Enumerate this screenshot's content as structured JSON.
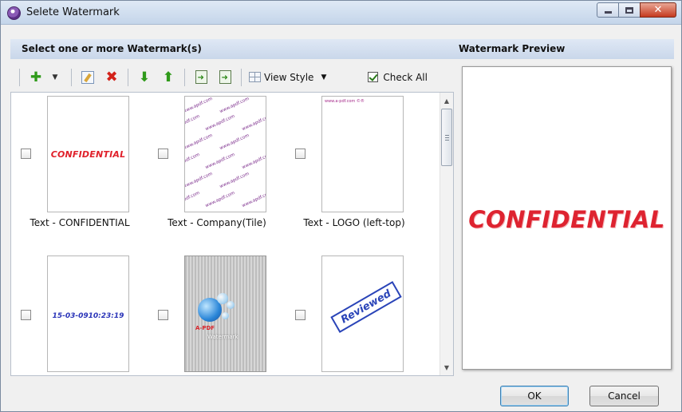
{
  "window": {
    "title": "Selete Watermark"
  },
  "left_panel": {
    "header": "Select one or more Watermark(s)"
  },
  "toolbar": {
    "view_style_label": "View Style",
    "check_all_label": "Check All",
    "check_all_checked": true
  },
  "watermarks": [
    {
      "caption": "Text - CONFIDENTIAL",
      "thumb_text": "CONFIDENTIAL",
      "checked": false
    },
    {
      "caption": "Text - Company(Tile)",
      "thumb_text": "www.apdf.com",
      "checked": false
    },
    {
      "caption": "Text - LOGO (left-top)",
      "thumb_text": "www.a-pdf.com ©®",
      "checked": false
    },
    {
      "caption": "",
      "thumb_text": "15-03-0910:23:19",
      "checked": false
    },
    {
      "caption": "",
      "thumb_text": "A-PDF",
      "thumb_text2": "Watermark",
      "checked": false
    },
    {
      "caption": "",
      "thumb_text": "Reviewed",
      "checked": false
    }
  ],
  "preview": {
    "header": "Watermark Preview",
    "text": "CONFIDENTIAL"
  },
  "buttons": {
    "ok": "OK",
    "cancel": "Cancel"
  },
  "colors": {
    "confidential_red": "#e0202a",
    "date_blue": "#2a34b8",
    "stamp_blue": "#2a44b8"
  }
}
